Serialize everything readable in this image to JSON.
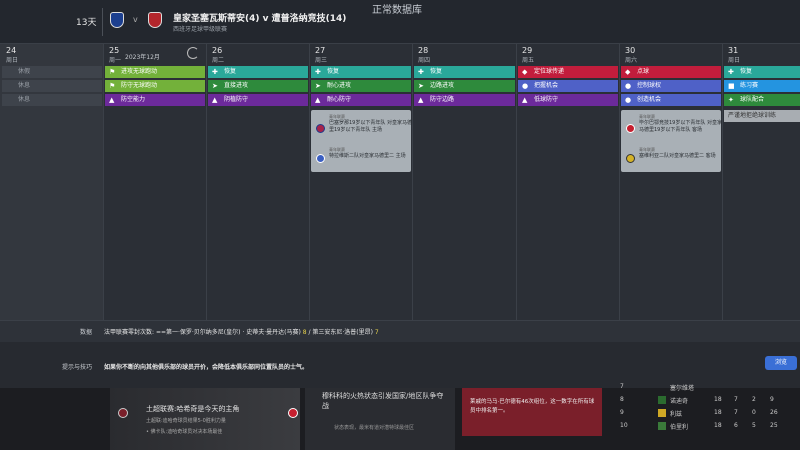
{
  "screen_title": "正常数据库",
  "days_left": "13天",
  "match": {
    "vs": "v",
    "title": "皇家圣塞瓦斯蒂安(4) v 遭普洛纳竞技(14)",
    "competition": "西班牙足球甲级联赛"
  },
  "calendar": {
    "month_label": "2023年12月",
    "days": [
      {
        "num": "24",
        "weekday": "周日"
      },
      {
        "num": "25",
        "weekday": "周一"
      },
      {
        "num": "26",
        "weekday": "周二"
      },
      {
        "num": "27",
        "weekday": "周三"
      },
      {
        "num": "28",
        "weekday": "周四"
      },
      {
        "num": "29",
        "weekday": "周五"
      },
      {
        "num": "30",
        "weekday": "周六"
      },
      {
        "num": "31",
        "weekday": "周日"
      }
    ],
    "day24_slots": [
      "休假",
      "休息",
      "休息"
    ],
    "day25_slots": [
      "进攻无球跑动",
      "防守无球跑动",
      "防空能力"
    ],
    "day26_slots": [
      "恢复",
      "直接进攻",
      "阴植防守"
    ],
    "day27_slots": [
      "恢复",
      "耐心进攻",
      "耐心防守"
    ],
    "day28_slots": [
      "恢复",
      "边路进攻",
      "防守边路"
    ],
    "day29_slots": [
      "定位球传递",
      "把握机会",
      "低球防守"
    ],
    "day30_slots": [
      "点球",
      "控制球权",
      "创造机会"
    ],
    "day31_slots": [
      "恢复",
      "练习赛",
      "球队配合"
    ],
    "day31_extra": "严谨地拒绝球训练",
    "card27": {
      "a_small": "青年联赛",
      "a_text": "巴塞罗那19岁以下青年队 对皇家马德里19岁以下青年队 主场",
      "b_small": "青年联赛",
      "b_text": "特拉维斯二队对皇家马德里二 主场"
    },
    "card30": {
      "a_small": "青年联赛",
      "a_text": "毕尔巴鄂竞技19岁以下青年队 对皇家马德里19岁以下青年队 客场",
      "b_small": "青年联赛",
      "b_text": "塞维利亚二队对皇家马德里二 客场"
    }
  },
  "data_row": {
    "label": "数据",
    "prefix": "法甲联赛零封次数: ",
    "text_a": "==第一·保罗·贝尔纳多尼(皇尔) · 史蒂夫·曼丹达(马赛) ",
    "num_a": "8",
    "text_b": " / 第三安东尼·洛普(里昂) ",
    "num_b": "7"
  },
  "tip_row": {
    "label": "提示与技巧",
    "text": "如果你不断的向其他俱乐部的球员开价，会降低本俱乐部同位置队员的士气。",
    "button": "浏览"
  },
  "news": {
    "left_title": "土超联赛:哈希奇是今天的主角",
    "left_sub1": "土超联:迪哈奇球员结果5-0胜利力量",
    "left_sub2": "• 佛卡队:迪哈奇球员对决本场最佳",
    "mid_title": "穆科科的火热状态引发国家/地区队争夺战",
    "mid_sub": "状态表现，最米有道对潜特球最佳区",
    "red_text": "莱戚的马马·巴尔德有46次组位，这一数字在所有球员中排名第一。",
    "table": [
      {
        "pos": "7",
        "team": "塞尔维塔",
        "a": "",
        "b": "",
        "c": "",
        "d": ""
      },
      {
        "pos": "8",
        "team": "诺迪奇",
        "a": "18",
        "b": "7",
        "c": "2",
        "d": "9"
      },
      {
        "pos": "9",
        "team": "利兹",
        "a": "18",
        "b": "7",
        "c": "0",
        "d": "26"
      },
      {
        "pos": "10",
        "team": "伯里利",
        "a": "18",
        "b": "6",
        "c": "5",
        "d": "25"
      }
    ]
  }
}
